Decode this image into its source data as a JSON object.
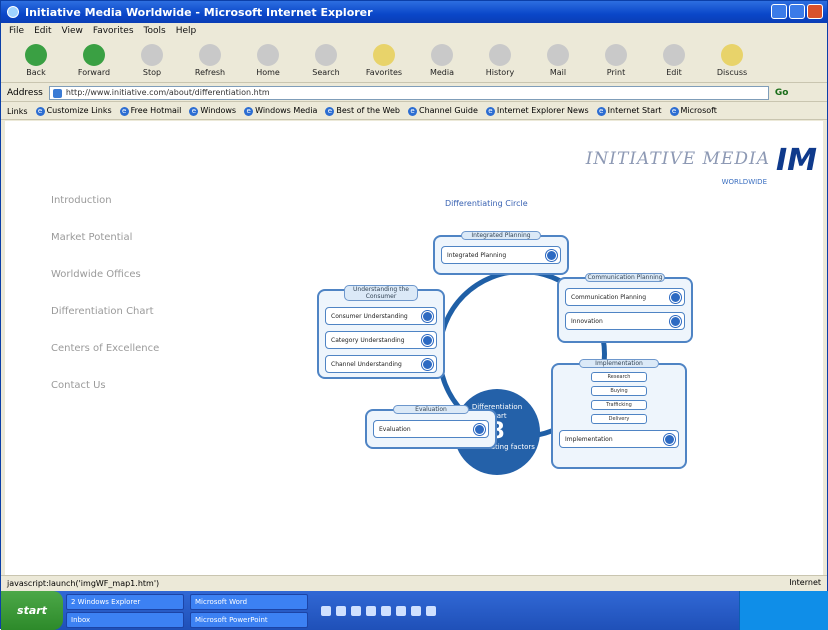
{
  "window": {
    "title": "Initiative Media Worldwide - Microsoft Internet Explorer"
  },
  "menu": [
    "File",
    "Edit",
    "View",
    "Favorites",
    "Tools",
    "Help"
  ],
  "toolbar": [
    {
      "label": "Back",
      "icon": "back-arrow-icon",
      "color": "#3aa043"
    },
    {
      "label": "Forward",
      "icon": "forward-arrow-icon",
      "color": "#3aa043"
    },
    {
      "label": "Stop",
      "icon": "stop-icon",
      "color": "#c9c9c9"
    },
    {
      "label": "Refresh",
      "icon": "refresh-icon",
      "color": "#c9c9c9"
    },
    {
      "label": "Home",
      "icon": "home-icon",
      "color": "#c9c9c9"
    },
    {
      "label": "Search",
      "icon": "search-icon",
      "color": "#c9c9c9"
    },
    {
      "label": "Favorites",
      "icon": "star-icon",
      "color": "#e8d36a"
    },
    {
      "label": "Media",
      "icon": "media-icon",
      "color": "#c9c9c9"
    },
    {
      "label": "History",
      "icon": "history-icon",
      "color": "#c9c9c9"
    },
    {
      "label": "Mail",
      "icon": "mail-icon",
      "color": "#c9c9c9"
    },
    {
      "label": "Print",
      "icon": "print-icon",
      "color": "#c9c9c9"
    },
    {
      "label": "Edit",
      "icon": "edit-icon",
      "color": "#c9c9c9"
    },
    {
      "label": "Discuss",
      "icon": "discuss-icon",
      "color": "#e8d36a"
    }
  ],
  "address": {
    "label": "Address",
    "value": "http://www.initiative.com/about/differentiation.htm",
    "go": "Go"
  },
  "links": {
    "label": "Links",
    "items": [
      "Customize Links",
      "Free Hotmail",
      "Windows",
      "Windows Media",
      "Best of the Web",
      "Channel Guide",
      "Internet Explorer News",
      "Internet Start",
      "Microsoft"
    ]
  },
  "brand": {
    "word": "INITIATIVE MEDIA",
    "mark": "IM",
    "sub": "WORLDWIDE"
  },
  "nav": [
    "Introduction",
    "Market Potential",
    "Worldwide Offices",
    "Differentiation Chart",
    "Centers of Excellence",
    "Contact Us"
  ],
  "diagram": {
    "title": "Differentiating Circle",
    "hub": {
      "top": "Differentiation",
      "mid": "Chart",
      "num": "8",
      "tail": "differentiating factors"
    },
    "panels": {
      "top": {
        "header": "Integrated Planning",
        "items": [
          "Integrated Planning"
        ]
      },
      "right": {
        "header": "Communication Planning",
        "items": [
          "Communication Planning",
          "Innovation"
        ]
      },
      "left": {
        "header": "Understanding the Consumer",
        "items": [
          "Consumer Understanding",
          "Category Understanding",
          "Channel Understanding"
        ]
      },
      "bottom_left": {
        "header": "Evaluation",
        "items": [
          "Evaluation"
        ]
      },
      "bottom_right": {
        "header": "Implementation",
        "sub_items": [
          "Research",
          "Buying",
          "Trafficking",
          "Delivery"
        ],
        "items": [
          "Implementation"
        ]
      }
    }
  },
  "status": {
    "url": "javascript:launch('imgWF_map1.htm')",
    "zone": "Internet"
  },
  "taskbar": {
    "start": "start",
    "tasks": [
      "2 Windows Explorer",
      "Inbox",
      "Microsoft Word",
      "Microsoft PowerPoint"
    ]
  }
}
